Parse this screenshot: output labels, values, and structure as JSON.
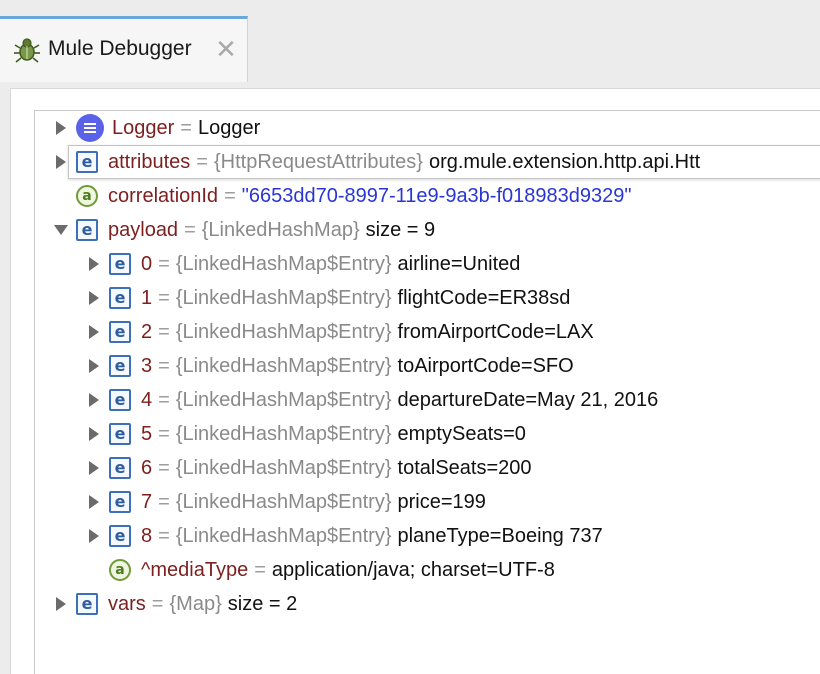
{
  "tab": {
    "title": "Mule Debugger",
    "icon": "bug-icon",
    "close": "✕"
  },
  "tree": {
    "logger": {
      "name": "Logger",
      "eq": "=",
      "value": "Logger"
    },
    "attributes": {
      "name": "attributes",
      "eq": "=",
      "type": "{HttpRequestAttributes}",
      "value": "org.mule.extension.http.api.Htt"
    },
    "correlationId": {
      "name": "correlationId",
      "eq": "=",
      "value": "\"6653dd70-8997-11e9-9a3b-f018983d9329\""
    },
    "payload": {
      "name": "payload",
      "eq": "=",
      "type": "{LinkedHashMap}",
      "value": "size = 9"
    },
    "entries": [
      {
        "name": "0",
        "type": "{LinkedHashMap$Entry}",
        "value": "airline=United"
      },
      {
        "name": "1",
        "type": "{LinkedHashMap$Entry}",
        "value": "flightCode=ER38sd"
      },
      {
        "name": "2",
        "type": "{LinkedHashMap$Entry}",
        "value": "fromAirportCode=LAX"
      },
      {
        "name": "3",
        "type": "{LinkedHashMap$Entry}",
        "value": "toAirportCode=SFO"
      },
      {
        "name": "4",
        "type": "{LinkedHashMap$Entry}",
        "value": "departureDate=May 21, 2016"
      },
      {
        "name": "5",
        "type": "{LinkedHashMap$Entry}",
        "value": "emptySeats=0"
      },
      {
        "name": "6",
        "type": "{LinkedHashMap$Entry}",
        "value": "totalSeats=200"
      },
      {
        "name": "7",
        "type": "{LinkedHashMap$Entry}",
        "value": "price=199"
      },
      {
        "name": "8",
        "type": "{LinkedHashMap$Entry}",
        "value": "planeType=Boeing 737"
      }
    ],
    "entry_eq": "=",
    "mediaType": {
      "name": "^mediaType",
      "eq": "=",
      "value": "application/java; charset=UTF-8"
    },
    "vars": {
      "name": "vars",
      "eq": "=",
      "type": "{Map}",
      "value": "size = 2"
    }
  },
  "icons": {
    "object": "e",
    "attribute": "a"
  }
}
